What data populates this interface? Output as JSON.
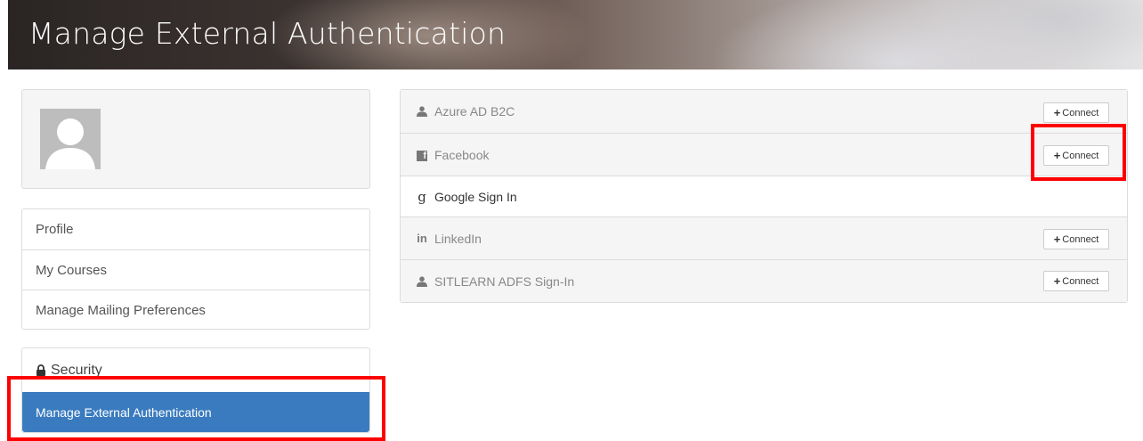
{
  "header": {
    "title": "Manage External Authentication"
  },
  "nav": {
    "items": [
      {
        "label": "Profile"
      },
      {
        "label": "My Courses"
      },
      {
        "label": "Manage Mailing Preferences"
      }
    ]
  },
  "security": {
    "header": "Security",
    "active_item": "Manage External Authentication"
  },
  "providers": [
    {
      "name": "Azure AD B2C",
      "icon": "user-icon",
      "connect_label": "Connect"
    },
    {
      "name": "Facebook",
      "icon": "facebook-icon",
      "connect_label": "Connect"
    },
    {
      "name": "Google Sign In",
      "icon": "google-icon"
    },
    {
      "name": "LinkedIn",
      "icon": "linkedin-icon",
      "connect_label": "Connect"
    },
    {
      "name": "SITLEARN ADFS Sign-In",
      "icon": "user-icon",
      "connect_label": "Connect"
    }
  ],
  "colors": {
    "active_nav": "#3a7bbf",
    "highlight": "#ff0000"
  }
}
